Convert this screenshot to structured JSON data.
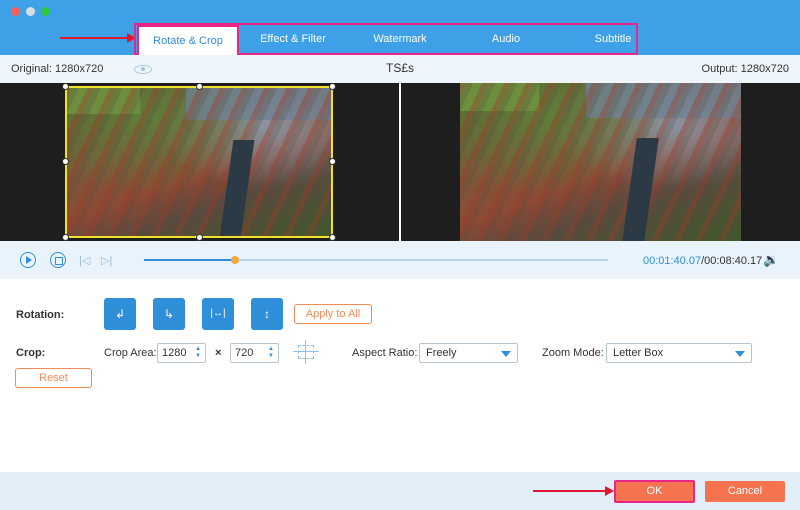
{
  "window": {
    "controls": [
      "close",
      "minimize",
      "zoom"
    ]
  },
  "tabs": [
    {
      "label": "Rotate & Crop",
      "active": true
    },
    {
      "label": "Effect & Filter",
      "active": false
    },
    {
      "label": "Watermark",
      "active": false
    },
    {
      "label": "Audio",
      "active": false
    },
    {
      "label": "Subtitle",
      "active": false
    }
  ],
  "info": {
    "original": "Original: 1280x720",
    "filename": "TS£s",
    "output": "Output: 1280x720"
  },
  "playback": {
    "current_time": "00:01:40.07",
    "total_time": "/00:08:40.17",
    "progress": 0.197
  },
  "rotation": {
    "label": "Rotation:",
    "buttons": [
      {
        "name": "rotate-left",
        "glyph": "↲"
      },
      {
        "name": "rotate-right",
        "glyph": "↳"
      },
      {
        "name": "flip-horizontal",
        "glyph": "|↔|"
      },
      {
        "name": "flip-vertical",
        "glyph": "↕"
      }
    ],
    "apply_all": "Apply to All"
  },
  "crop": {
    "label": "Crop:",
    "area_label": "Crop Area:",
    "width": "1280",
    "times": "×",
    "height": "720",
    "aspect_label": "Aspect Ratio:",
    "aspect_value": "Freely",
    "zoom_label": "Zoom Mode:",
    "zoom_value": "Letter Box",
    "reset": "Reset"
  },
  "footer": {
    "ok": "OK",
    "cancel": "Cancel"
  },
  "colors": {
    "accent": "#2f8fd8",
    "titlebar": "#3ea0e6",
    "highlight": "#e8268a",
    "orange": "#f5734f",
    "crop_border": "#f0e22a"
  }
}
